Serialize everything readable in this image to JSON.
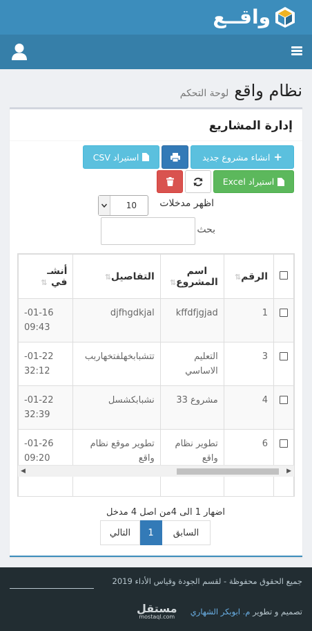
{
  "header": {
    "brand_name": "واقــع",
    "brand_icon": "cube-logo"
  },
  "navbar": {
    "menu_icon": "hamburger-icon",
    "user_icon": "user-icon"
  },
  "page": {
    "title": "نظام واقع",
    "subtitle": "لوحة التحكم"
  },
  "box": {
    "title": "إدارة المشاريع"
  },
  "toolbar": {
    "new_project_label": "انشاء مشروع جديد",
    "print_icon": "print-icon",
    "import_csv_label": "استيراد CSV",
    "import_excel_label": "استيراد Excel",
    "refresh_icon": "refresh-icon",
    "delete_icon": "trash-icon"
  },
  "length": {
    "label": "اظهر مدخلات",
    "value": "10"
  },
  "search": {
    "label": "بحث",
    "value": ""
  },
  "table": {
    "columns": [
      "الرقم",
      "اسم المشروع",
      "التفاصيل",
      "أنشئ في"
    ],
    "column_display": [
      "الرقم",
      "اسم\nالمشروع",
      "التفاصيل",
      "أنشـ\nفي"
    ],
    "rows": [
      {
        "id": "1",
        "name": "kffdfjgjad",
        "details": "djfhgdkjal",
        "date": "-01-16\n09:43"
      },
      {
        "id": "3",
        "name": "التعليم\nالاساسي",
        "details": "تتشبابخهلفتخهاربب",
        "date": "-01-22\n32:12"
      },
      {
        "id": "4",
        "name": "مشروع 33",
        "details": "نشبابكشسل",
        "date": "-01-22\n32:39"
      },
      {
        "id": "6",
        "name": "تطوير نظام\nواقع",
        "details": "تطوير موقع نظام\nواقع",
        "date": "-01-26\n09:20"
      }
    ]
  },
  "info": {
    "text": "اضهار 1 الى 4من اصل 4 مدخل"
  },
  "pagination": {
    "prev": "السابق",
    "current": "1",
    "next": "التالي"
  },
  "footer": {
    "copyright": "جميع الحقوق محفوظة - لقسم الجودة وقياس الأداء 2019",
    "credits_prefix": "تصميم و تطوير",
    "author": "م. ابوبكر الشهاري",
    "badge_ar": "مستقل",
    "badge_en": "mostaql.com"
  },
  "colors": {
    "header": "#3c8dbc",
    "navbar": "#367fa9",
    "footer": "#222d32",
    "primary": "#337ab7",
    "info": "#5bc0de",
    "success": "#5cb85c",
    "danger": "#d9534f"
  }
}
